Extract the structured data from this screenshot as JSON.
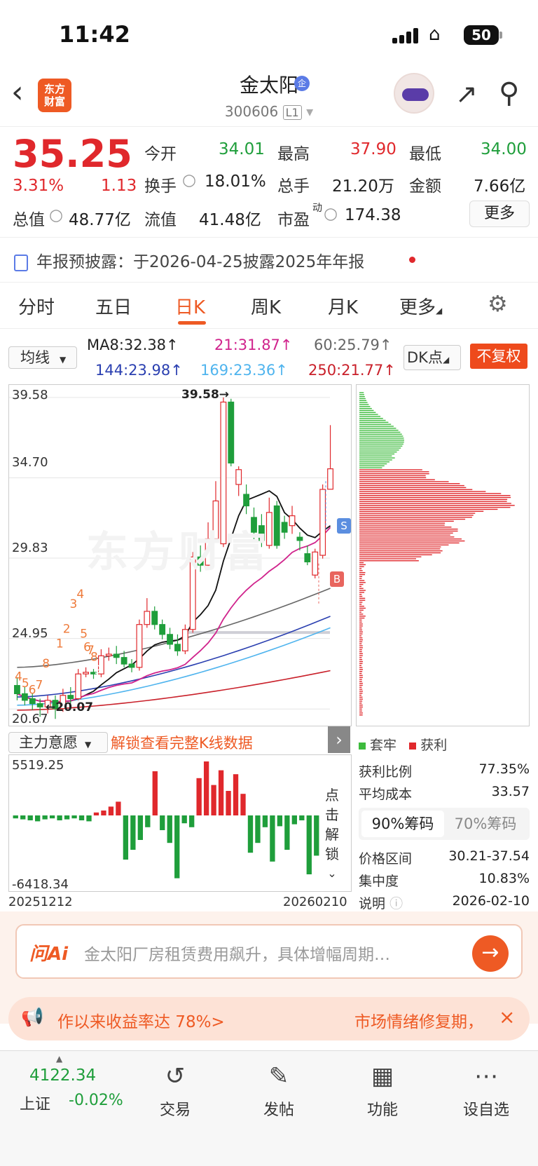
{
  "status_bar": {
    "time": "11:42",
    "battery": "50"
  },
  "header": {
    "back_icon": "back-chevron-icon",
    "logo_text_1": "东方",
    "logo_text_2": "财富",
    "stock_name": "金太阳",
    "badge": "企",
    "code": "300606",
    "level": "L1"
  },
  "quote": {
    "price": "35.25",
    "change_pct": "3.31%",
    "change": "1.13",
    "open_label": "今开",
    "open": "34.01",
    "high_label": "最高",
    "high": "37.90",
    "low_label": "最低",
    "low": "34.00",
    "turnover_label": "换手",
    "turnover": "18.01%",
    "volume_label": "总手",
    "volume": "21.20万",
    "amount_label": "金额",
    "amount": "7.66亿",
    "mktcap_label": "总值",
    "mktcap": "48.77亿",
    "float_label": "流值",
    "float_cap": "41.48亿",
    "pe_label": "市盈",
    "pe_sup": "动",
    "pe": "174.38",
    "more": "更多"
  },
  "notice": {
    "label": "年报预披露：",
    "text": "于2026-04-25披露2025年年报"
  },
  "tabs": [
    "分时",
    "五日",
    "日K",
    "周K",
    "月K",
    "更多"
  ],
  "active_tab": "日K",
  "ma_bar": {
    "selector": "均线",
    "ma8": "MA8:32.38",
    "ma21": "21:31.87",
    "ma60": "60:25.79",
    "ma144": "144:23.98",
    "ma169": "169:23.36",
    "ma250": "250:21.77",
    "dk": "DK点",
    "fq": "不复权"
  },
  "chart_data": {
    "type": "candlestick",
    "y_ticks": [
      "39.58",
      "34.70",
      "29.83",
      "24.95",
      "20.67"
    ],
    "ylim": [
      20.0,
      40.0
    ],
    "max_label": "39.58",
    "min_label": "20.07",
    "watermark": "东方财富",
    "signals": [
      "S",
      "B"
    ],
    "seq_labels": [
      "4",
      "5",
      "6",
      "7",
      "8",
      "9",
      "1",
      "2",
      "3",
      "4",
      "5",
      "6",
      "7",
      "8",
      "9"
    ],
    "candles": [
      {
        "o": 22.1,
        "c": 21.6,
        "h": 22.6,
        "l": 21.2
      },
      {
        "o": 21.6,
        "c": 21.2,
        "h": 22.0,
        "l": 20.9
      },
      {
        "o": 21.3,
        "c": 21.0,
        "h": 21.6,
        "l": 20.6
      },
      {
        "o": 21.0,
        "c": 20.8,
        "h": 21.3,
        "l": 20.2
      },
      {
        "o": 20.8,
        "c": 21.2,
        "h": 21.5,
        "l": 20.4
      },
      {
        "o": 21.2,
        "c": 20.7,
        "h": 21.5,
        "l": 20.07
      },
      {
        "o": 20.7,
        "c": 21.5,
        "h": 21.9,
        "l": 20.5
      },
      {
        "o": 21.5,
        "c": 21.3,
        "h": 22.0,
        "l": 21.0
      },
      {
        "o": 21.3,
        "c": 22.8,
        "h": 23.1,
        "l": 21.2
      },
      {
        "o": 22.8,
        "c": 22.9,
        "h": 23.2,
        "l": 22.6
      },
      {
        "o": 22.9,
        "c": 22.8,
        "h": 23.1,
        "l": 22.5
      },
      {
        "o": 22.8,
        "c": 23.9,
        "h": 24.3,
        "l": 22.6
      },
      {
        "o": 23.9,
        "c": 24.0,
        "h": 24.4,
        "l": 23.6
      },
      {
        "o": 24.0,
        "c": 23.8,
        "h": 24.5,
        "l": 23.4
      },
      {
        "o": 23.8,
        "c": 23.4,
        "h": 24.2,
        "l": 23.2
      },
      {
        "o": 23.4,
        "c": 23.2,
        "h": 23.7,
        "l": 22.9
      },
      {
        "o": 23.2,
        "c": 25.8,
        "h": 26.1,
        "l": 23.0
      },
      {
        "o": 25.8,
        "c": 26.6,
        "h": 27.4,
        "l": 25.6
      },
      {
        "o": 26.6,
        "c": 25.8,
        "h": 26.9,
        "l": 25.5
      },
      {
        "o": 25.8,
        "c": 25.2,
        "h": 26.1,
        "l": 24.9
      },
      {
        "o": 25.2,
        "c": 24.6,
        "h": 25.6,
        "l": 24.3
      },
      {
        "o": 24.6,
        "c": 24.2,
        "h": 25.2,
        "l": 23.9
      },
      {
        "o": 24.2,
        "c": 25.5,
        "h": 25.8,
        "l": 24.0
      },
      {
        "o": 25.5,
        "c": 29.9,
        "h": 30.2,
        "l": 25.3
      },
      {
        "o": 29.9,
        "c": 29.4,
        "h": 30.6,
        "l": 29.0
      },
      {
        "o": 29.4,
        "c": 31.0,
        "h": 32.0,
        "l": 29.2
      },
      {
        "o": 31.0,
        "c": 33.3,
        "h": 34.5,
        "l": 30.8
      },
      {
        "o": 30.7,
        "c": 39.3,
        "h": 39.58,
        "l": 30.5
      },
      {
        "o": 39.3,
        "c": 35.6,
        "h": 39.5,
        "l": 35.4
      },
      {
        "o": 34.3,
        "c": 35.2,
        "h": 35.4,
        "l": 33.6
      },
      {
        "o": 33.7,
        "c": 33.0,
        "h": 34.3,
        "l": 32.5
      },
      {
        "o": 32.3,
        "c": 31.4,
        "h": 32.9,
        "l": 30.9
      },
      {
        "o": 31.8,
        "c": 30.9,
        "h": 32.5,
        "l": 30.5
      },
      {
        "o": 30.6,
        "c": 32.6,
        "h": 33.5,
        "l": 30.4
      },
      {
        "o": 33.0,
        "c": 30.6,
        "h": 33.3,
        "l": 30.4
      },
      {
        "o": 32.0,
        "c": 31.4,
        "h": 32.4,
        "l": 31.0
      },
      {
        "o": 31.8,
        "c": 32.4,
        "h": 33.0,
        "l": 31.3
      },
      {
        "o": 31.1,
        "c": 30.9,
        "h": 31.4,
        "l": 30.3
      },
      {
        "o": 30.1,
        "c": 29.6,
        "h": 30.6,
        "l": 29.4
      },
      {
        "o": 28.8,
        "c": 30.2,
        "h": 30.4,
        "l": 28.6
      },
      {
        "o": 30.0,
        "c": 34.0,
        "h": 34.3,
        "l": 29.8
      },
      {
        "o": 34.01,
        "c": 35.25,
        "h": 37.9,
        "l": 34.0
      }
    ]
  },
  "chips": {
    "legend_trapped": "套牢",
    "legend_profit": "获利",
    "profit_ratio_label": "获利比例",
    "profit_ratio": "77.35%",
    "avg_cost_label": "平均成本",
    "avg_cost": "33.57",
    "seg_90": "90%筹码",
    "seg_70": "70%筹码",
    "range_label": "价格区间",
    "range": "30.21-37.54",
    "concentration_label": "集中度",
    "concentration": "10.83%",
    "note_label": "说明",
    "note_date": "2026-02-10"
  },
  "sub_chart": {
    "selector": "主力意愿",
    "unlock": "解锁查看完整K线数据",
    "max": "5519.25",
    "min": "-6418.34",
    "side_text": "点击解锁",
    "start_date": "20251212",
    "end_date": "20260210",
    "bars": [
      -0.3,
      -0.4,
      -0.5,
      -0.6,
      -0.4,
      -0.3,
      -0.5,
      -0.4,
      -0.3,
      -0.5,
      -0.6,
      0.3,
      0.5,
      0.9,
      1.4,
      -4.5,
      -3.5,
      -2.5,
      -1.2,
      4.5,
      -1.5,
      -2.8,
      -6.4,
      -0.8,
      -1.2,
      3.8,
      5.5,
      3.1,
      4.6,
      2.5,
      4.2,
      2.2,
      -3.8,
      -2.8,
      -1.2,
      -4.7,
      -1.1,
      -3.5,
      -0.9,
      -0.5,
      -6.0,
      -4.1
    ]
  },
  "ai_bar": {
    "logo": "问Ai",
    "text": "金太阳厂房租赁费用飙升，具体增幅周期…"
  },
  "promo": {
    "left": "作以来收益率达 78%>",
    "right": "市场情绪修复期，"
  },
  "bottom_nav": {
    "index_value": "4122.34",
    "index_name": "上证",
    "index_change": "-0.02%",
    "items": [
      "交易",
      "发帖",
      "功能",
      "设自选"
    ]
  }
}
